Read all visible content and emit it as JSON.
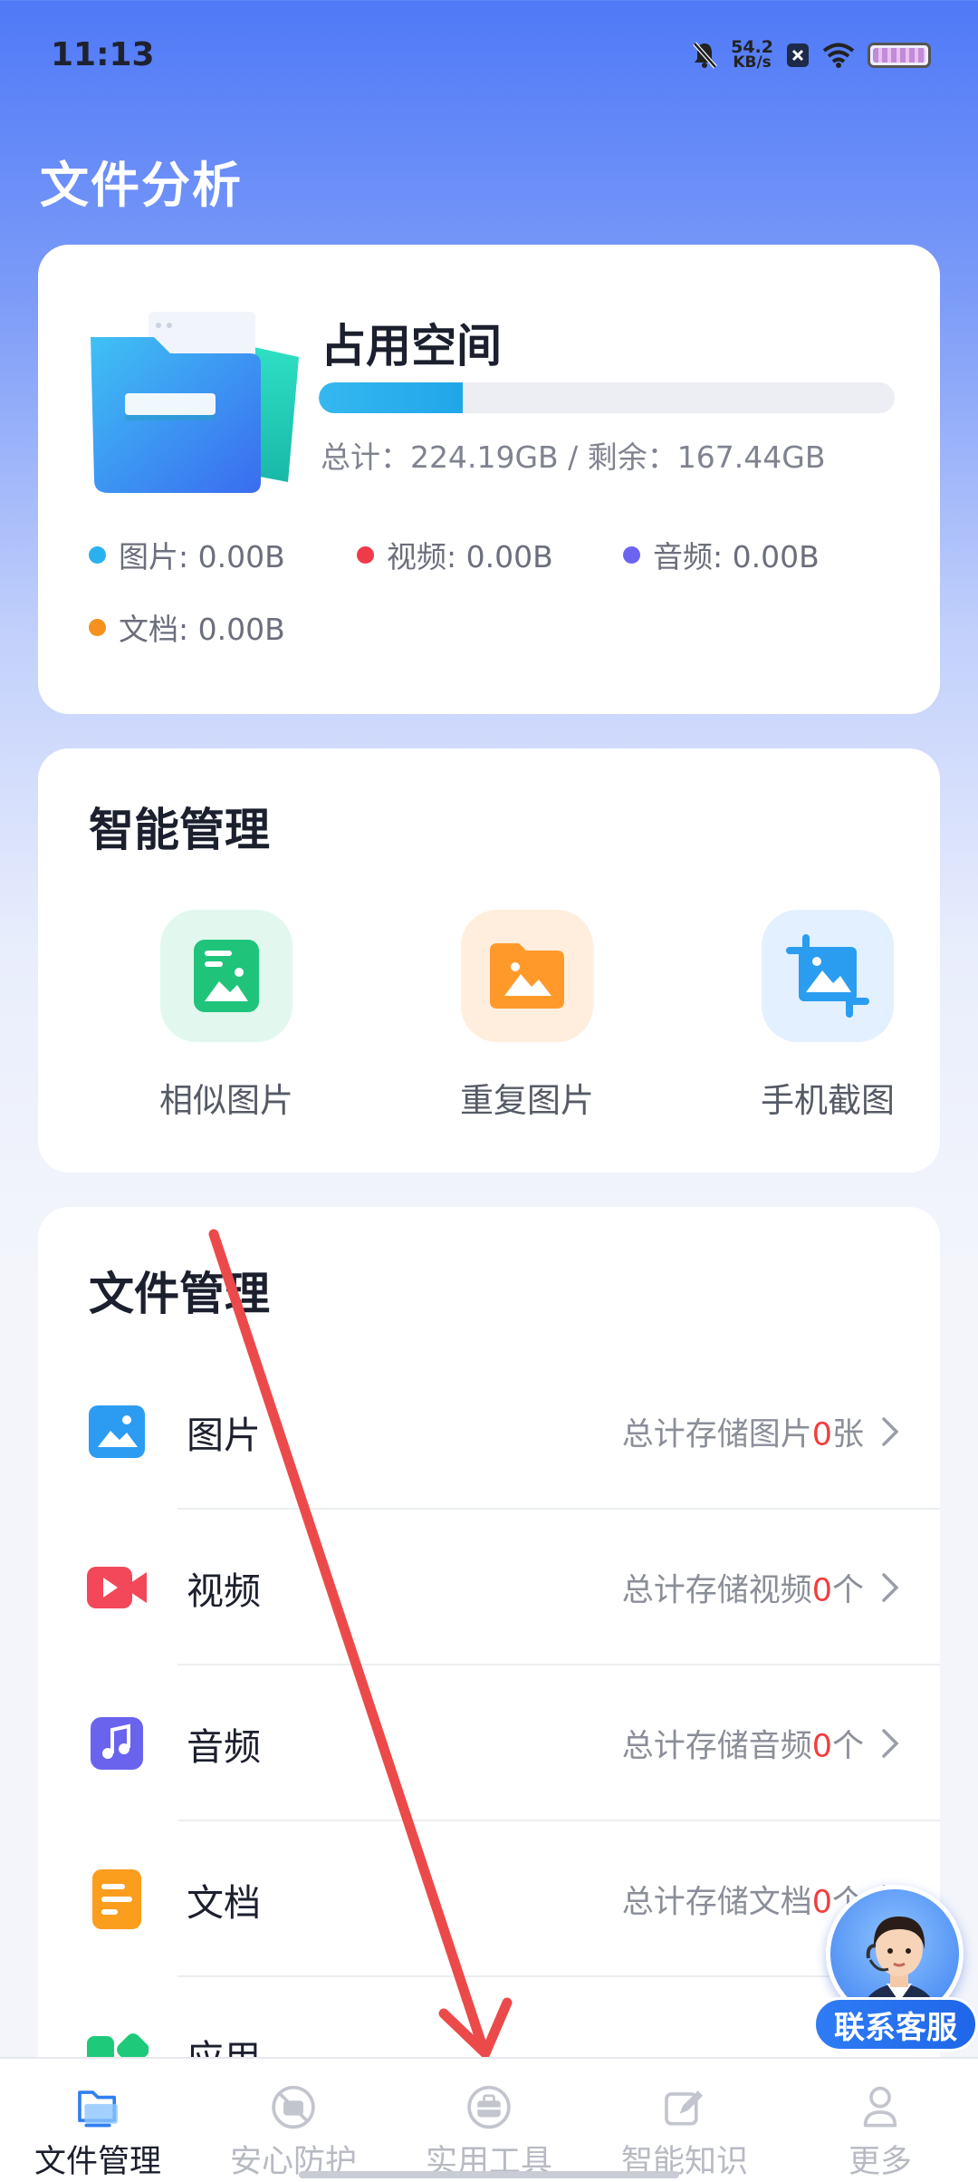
{
  "status_bar": {
    "time": "11:13",
    "net_speed_value": "54.2",
    "net_speed_unit": "KB/s",
    "icons": [
      "mute-bell-icon",
      "close-box-icon",
      "wifi-icon",
      "battery-icon"
    ]
  },
  "page_title": "文件分析",
  "storage": {
    "title": "占用空间",
    "used_fraction": 0.25,
    "summary": "总计：224.19GB / 剩余：167.44GB",
    "legend": [
      {
        "label": "图片: 0.00B",
        "color": "#2ab0ef"
      },
      {
        "label": "视频: 0.00B",
        "color": "#ef3a4a"
      },
      {
        "label": "音频: 0.00B",
        "color": "#6c63f0"
      },
      {
        "label": "文档: 0.00B",
        "color": "#f5911e"
      }
    ]
  },
  "smart_management": {
    "title": "智能管理",
    "items": [
      {
        "label": "相似图片",
        "icon": "similar-image-icon",
        "bg": "#e2f8ee",
        "color": "#1fc47a"
      },
      {
        "label": "重复图片",
        "icon": "duplicate-image-icon",
        "bg": "#ffeedd",
        "color": "#ff9a2a"
      },
      {
        "label": "手机截图",
        "icon": "screenshot-icon",
        "bg": "#e3f0ff",
        "color": "#2a9df0"
      }
    ]
  },
  "file_management": {
    "title": "文件管理",
    "rows": [
      {
        "name": "图片",
        "stat_prefix": "总计存储图片",
        "stat_count": "0",
        "stat_unit": "张",
        "icon": "image-file-icon"
      },
      {
        "name": "视频",
        "stat_prefix": "总计存储视频",
        "stat_count": "0",
        "stat_unit": "个",
        "icon": "video-file-icon"
      },
      {
        "name": "音频",
        "stat_prefix": "总计存储音频",
        "stat_count": "0",
        "stat_unit": "个",
        "icon": "audio-file-icon"
      },
      {
        "name": "文档",
        "stat_prefix": "总计存储文档",
        "stat_count": "0",
        "stat_unit": "个",
        "icon": "document-file-icon"
      },
      {
        "name": "应用",
        "icon": "app-file-icon"
      }
    ]
  },
  "service": {
    "label": "联系客服"
  },
  "bottom_nav": [
    {
      "label": "文件管理",
      "icon": "folder-icon",
      "active": true
    },
    {
      "label": "安心防护",
      "icon": "shield-camera-icon",
      "active": false
    },
    {
      "label": "实用工具",
      "icon": "toolbox-icon",
      "active": false
    },
    {
      "label": "智能知识",
      "icon": "edit-icon",
      "active": false
    },
    {
      "label": "更多",
      "icon": "person-icon",
      "active": false
    }
  ]
}
